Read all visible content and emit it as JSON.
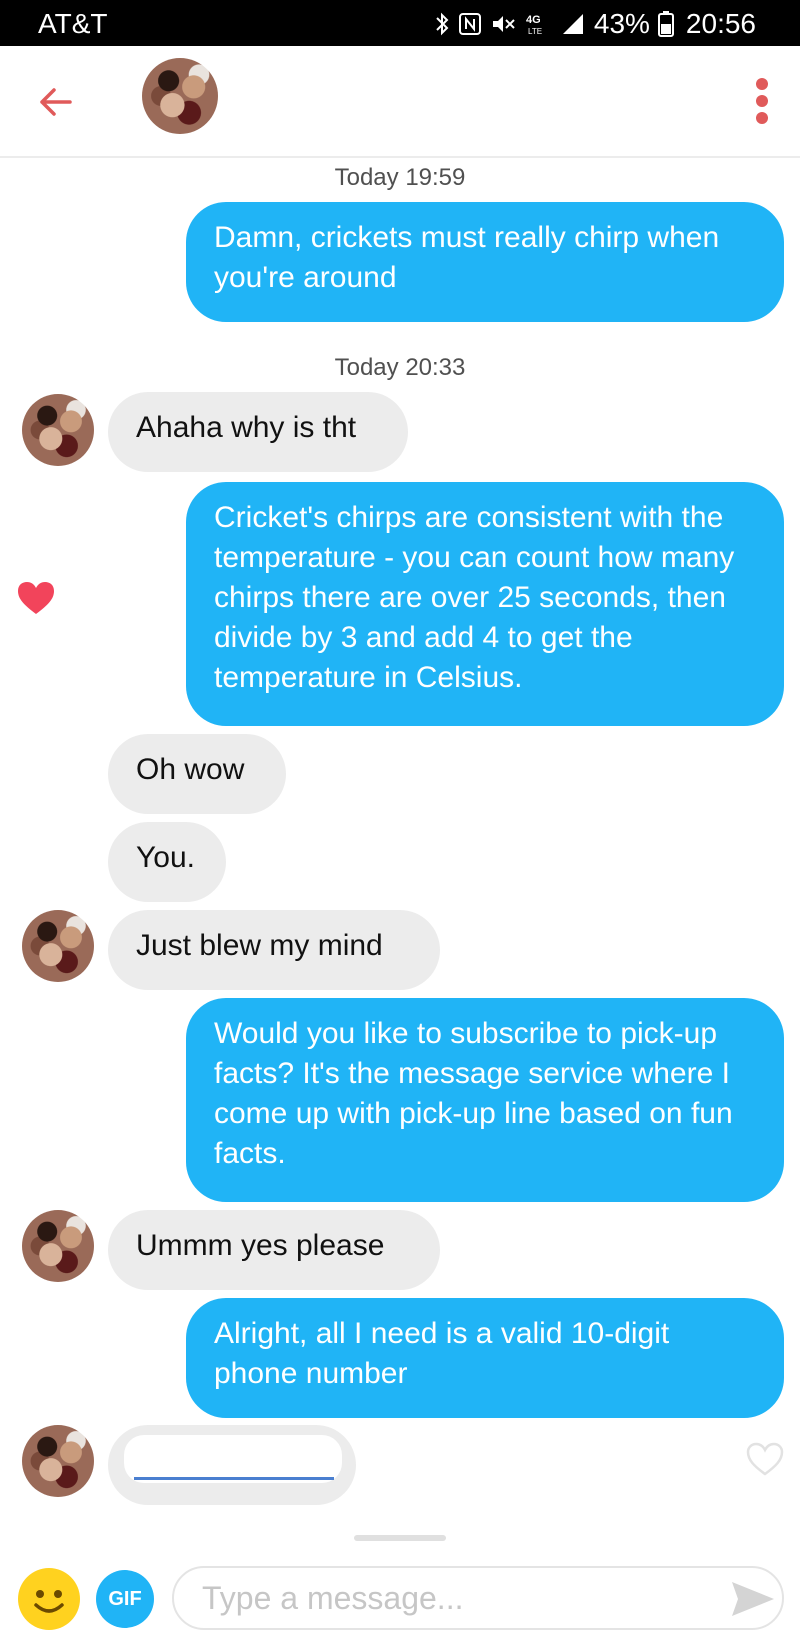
{
  "status_bar": {
    "carrier": "AT&T",
    "battery": "43%",
    "time": "20:56",
    "icons": [
      "bluetooth-icon",
      "nfc-icon",
      "mute-icon",
      "4g-lte-icon",
      "signal-icon",
      "battery-icon"
    ]
  },
  "header": {
    "back_icon": "arrow-left-icon",
    "menu_icon": "more-vertical-icon"
  },
  "colors": {
    "accent": "#20b4f6",
    "back_arrow": "#e05a5a",
    "like": "#f2445b",
    "incoming_bubble": "#ececec"
  },
  "chat": {
    "timestamps": [
      "Today 19:59",
      "Today 20:33"
    ],
    "messages": [
      {
        "from": "me",
        "text": "Damn, crickets must really chirp when you're around"
      },
      {
        "from": "them",
        "text": "Ahaha why is tht"
      },
      {
        "from": "me",
        "text": "Cricket's chirps are consistent with the temperature - you can count how many chirps there are over 25 seconds, then divide by 3 and add 4 to get the temperature in Celsius.",
        "liked": true
      },
      {
        "from": "them",
        "text": "Oh wow"
      },
      {
        "from": "them",
        "text": "You."
      },
      {
        "from": "them",
        "text": "Just blew my mind"
      },
      {
        "from": "me",
        "text": "Would you like to subscribe to pick-up facts? It's the message service where I come up with pick-up line based on fun facts."
      },
      {
        "from": "them",
        "text": "Ummm yes please"
      },
      {
        "from": "me",
        "text": "Alright, all I need is a valid 10-digit phone number"
      },
      {
        "from": "them",
        "text": ""
      }
    ]
  },
  "composer": {
    "gif_label": "GIF",
    "placeholder": "Type a message...",
    "emoji_icon": "smiley-icon",
    "send_icon": "send-icon"
  }
}
